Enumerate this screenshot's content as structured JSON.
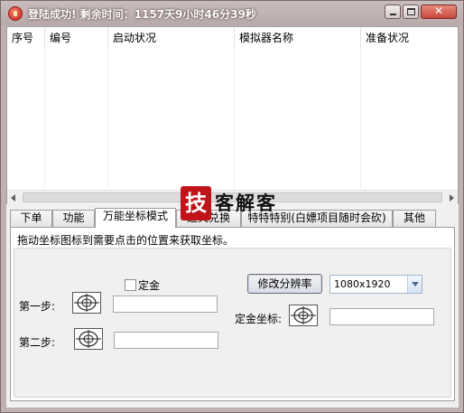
{
  "window": {
    "title": "登陆成功! 剩余时间：1157天9小时46分39秒",
    "min_label": "minimize",
    "max_label": "maximize",
    "close_glyph": "✕"
  },
  "grid": {
    "columns": [
      "序号",
      "编号",
      "启动状况",
      "模拟器名称",
      "准备状况"
    ],
    "rows": []
  },
  "tabs": [
    {
      "label": "下单",
      "active": false
    },
    {
      "label": "功能",
      "active": false
    },
    {
      "label": "万能坐标模式",
      "active": true
    },
    {
      "label": "道具兑换",
      "active": false
    },
    {
      "label": "特特特别(白嫖项目随时会砍)",
      "active": false
    },
    {
      "label": "其他",
      "active": false
    }
  ],
  "panel": {
    "hint": "拖动坐标图标到需要点击的位置来获取坐标。",
    "checkbox_label": "定金",
    "checkbox_checked": false,
    "step1_label": "第一步:",
    "step2_label": "第二步:",
    "step1_value": "",
    "step2_value": "",
    "resolution_button": "修改分辨率",
    "resolution_selected": "1080x1920",
    "deposit_coord_label": "定金坐标:",
    "deposit_coord_value": ""
  },
  "watermark": {
    "badge": "技",
    "text": "客解客"
  },
  "icons": {
    "target": "crosshair-target-icon",
    "app": "app-icon"
  }
}
